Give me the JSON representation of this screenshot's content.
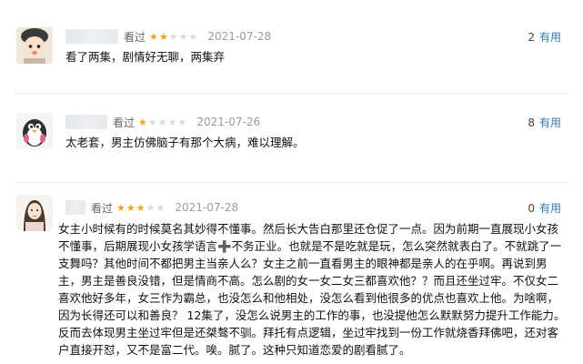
{
  "reviews": [
    {
      "rating_label": "看过",
      "stars": 2,
      "date": "2021-07-28",
      "votes": "2",
      "useful_label": "有用",
      "text": "看了两集，剧情好无聊，两集弃",
      "avatar_icon": "baby-avatar"
    },
    {
      "rating_label": "看过",
      "stars": 1,
      "date": "2021-07-26",
      "votes": "8",
      "useful_label": "有用",
      "text": "太老套，男主仿佛脑子有那个大病，难以理解。",
      "avatar_icon": "penguin-avatar"
    },
    {
      "rating_label": "看过",
      "stars": 3,
      "date": "2021-07-28",
      "votes": "0",
      "useful_label": "有用",
      "text": "女主小时候有的时候莫名其妙得不懂事。然后长大告白那里还仓促了一点。因为前期一直展现小女孩不懂事，后期展现小女孩学语言➕不务正业。也就是不是吃就是玩，怎么突然就表白了。不就跳了一支舞吗？其他时间不都把男主当亲人么？女主之前一直看男主的眼神都是亲人的在乎啊。再说到男主，男主是善良没错，但是情商不高。怎么剧的女一女二女三都喜欢他？？而且还坐过牢。不仅女二喜欢他好多年，女三作为霸总，也没怎么和他相处，没怎么看到他很多的优点也喜欢上他。为啥啊，因为长得还可以和善良？ 12集了，没怎么说男主的工作的事，也没提他怎么默默努力提升工作能力。反而去体现男主坐过牢但是还桀骜不驯。拜托有点逻辑，坐过牢找到一份工作就烧香拜佛吧，还对客户直接开怼，又不是富二代。唉。腻了。这种只知道恋爱的剧看腻了。",
      "avatar_icon": "woman-avatar"
    }
  ],
  "star_icon": "star-icon",
  "colors": {
    "star_on": "#f7a21a",
    "star_off": "#d9d9d9",
    "useful": "#3377aa",
    "date": "#9a9a9a"
  }
}
